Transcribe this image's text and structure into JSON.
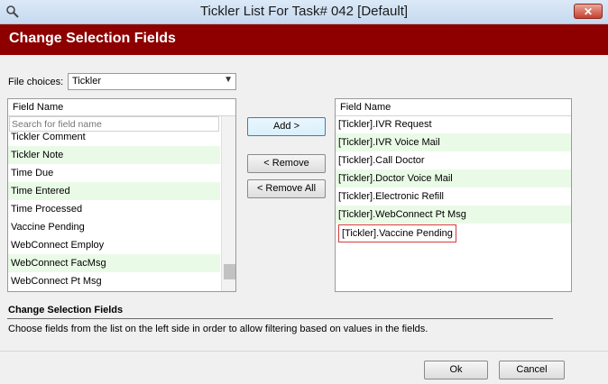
{
  "window": {
    "title": "Tickler List For Task# 042 [Default]",
    "close_glyph": "✕",
    "icon": "magnifier-icon"
  },
  "header": {
    "title": "Change Selection Fields"
  },
  "file_choices": {
    "label": "File choices:",
    "value": "Tickler"
  },
  "left_list": {
    "column_header": "Field Name",
    "search_placeholder": "Search for field name",
    "items": [
      {
        "label": "Tickler Comment",
        "alt": false
      },
      {
        "label": "Tickler Note",
        "alt": true
      },
      {
        "label": "Time Due",
        "alt": false
      },
      {
        "label": "Time Entered",
        "alt": true
      },
      {
        "label": "Time Processed",
        "alt": false
      },
      {
        "label": "Vaccine Pending",
        "alt": false
      },
      {
        "label": "WebConnect Employ",
        "alt": false
      },
      {
        "label": "WebConnect FacMsg",
        "alt": true
      },
      {
        "label": "WebConnect Pt Msg",
        "alt": false
      }
    ]
  },
  "buttons": {
    "add": "Add >",
    "remove": "< Remove",
    "remove_all": "< Remove All",
    "ok": "Ok",
    "cancel": "Cancel"
  },
  "right_list": {
    "column_header": "Field Name",
    "items": [
      {
        "label": "[Tickler].IVR Request",
        "alt": false
      },
      {
        "label": "[Tickler].IVR Voice Mail",
        "alt": true
      },
      {
        "label": "[Tickler].Call Doctor",
        "alt": false
      },
      {
        "label": "[Tickler].Doctor Voice Mail",
        "alt": true
      },
      {
        "label": "[Tickler].Electronic Refill",
        "alt": false
      },
      {
        "label": "[Tickler].WebConnect Pt Msg",
        "alt": true
      },
      {
        "label": "[Tickler].Vaccine Pending",
        "alt": false,
        "selected": true
      }
    ]
  },
  "info": {
    "title": "Change Selection Fields",
    "text": "Choose fields from the list on the left side in order to allow filtering based on values in the fields."
  }
}
